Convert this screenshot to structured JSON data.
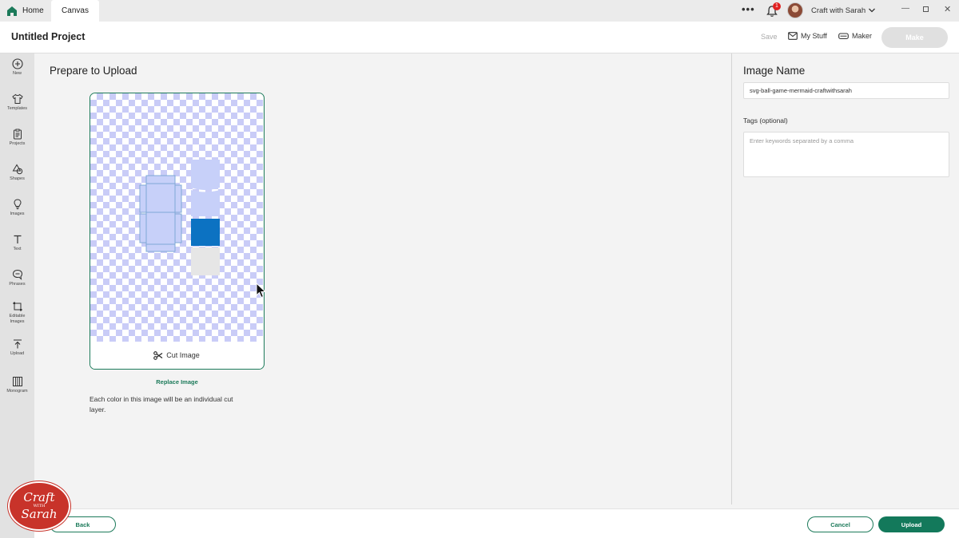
{
  "tabs": {
    "home": "Home",
    "canvas": "Canvas"
  },
  "topbar": {
    "more": "•••",
    "notification_count": "1",
    "user_name": "Craft with Sarah"
  },
  "header": {
    "project_title": "Untitled Project",
    "save": "Save",
    "my_stuff": "My Stuff",
    "maker": "Maker",
    "make": "Make"
  },
  "sidebar": {
    "items": [
      {
        "label": "New",
        "icon": "plus-circle-icon"
      },
      {
        "label": "Templates",
        "icon": "shirt-icon"
      },
      {
        "label": "Projects",
        "icon": "clipboard-icon"
      },
      {
        "label": "Shapes",
        "icon": "shapes-icon"
      },
      {
        "label": "Images",
        "icon": "lightbulb-icon"
      },
      {
        "label": "Text",
        "icon": "text-icon"
      },
      {
        "label": "Phrases",
        "icon": "speech-bubble-icon"
      },
      {
        "label": "Editable\nImages",
        "icon": "editable-images-icon"
      },
      {
        "label": "Upload",
        "icon": "upload-icon"
      },
      {
        "label": "Monogram",
        "icon": "monogram-icon"
      }
    ]
  },
  "main": {
    "title": "Prepare to Upload",
    "cut_image_label": "Cut Image",
    "replace_image": "Replace Image",
    "info": "Each color in this image will be an individual cut layer."
  },
  "right_panel": {
    "image_name_title": "Image Name",
    "image_name_value": "svg-ball-game-mermaid-craftwithsarah",
    "tags_label": "Tags (optional)",
    "tags_placeholder": "Enter keywords separated by a comma"
  },
  "footer": {
    "back": "Back",
    "cancel": "Cancel",
    "upload": "Upload"
  },
  "logo": {
    "line1": "Craft",
    "line2": "WITH",
    "line3": "Sarah"
  },
  "colors": {
    "accent": "#1c7a5a",
    "upload_button": "#13795b",
    "checker": "#c9ccf7",
    "layer_blue": "#0c72c2",
    "layer_light": "#c7d0f9"
  }
}
